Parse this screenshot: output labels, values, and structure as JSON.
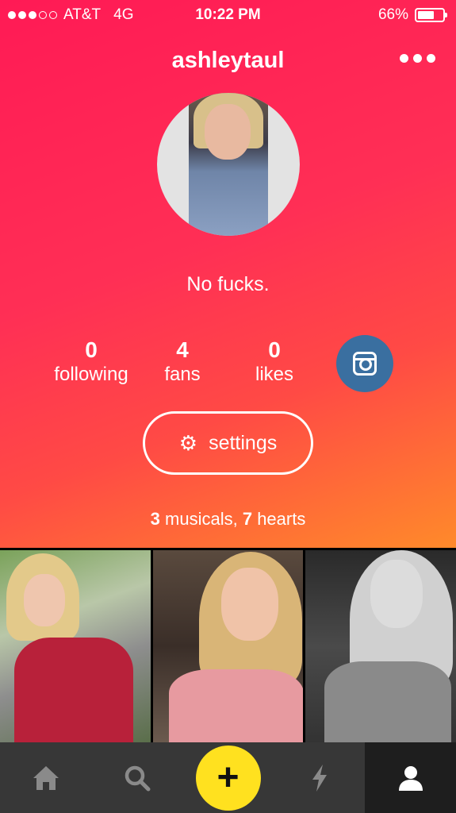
{
  "status_bar": {
    "carrier": "AT&T",
    "network": "4G",
    "time": "10:22 PM",
    "battery": "66%",
    "battery_level": 0.66,
    "signal_bars": 3
  },
  "profile": {
    "username": "ashleytaul",
    "bio": "No fucks.",
    "stats": [
      {
        "value": "0",
        "label": "following"
      },
      {
        "value": "4",
        "label": "fans"
      },
      {
        "value": "0",
        "label": "likes"
      }
    ],
    "settings_label": "settings",
    "summary": {
      "musicals_count": "3",
      "musicals_text": " musicals, ",
      "hearts_count": "7",
      "hearts_text": " hearts"
    }
  },
  "icons": {
    "more": "more-icon",
    "instagram": "instagram-icon",
    "settings": "gear-icon",
    "tabs": [
      "home-icon",
      "search-icon",
      "plus-icon",
      "lightning-icon",
      "profile-icon"
    ]
  },
  "tabs": {
    "active": "profile"
  },
  "colors": {
    "gradient_top": "#ff1a55",
    "gradient_bottom": "#ff8a2a",
    "instagram": "#3a6fa0",
    "create_button": "#ffe11f",
    "tabbar": "#373737"
  }
}
